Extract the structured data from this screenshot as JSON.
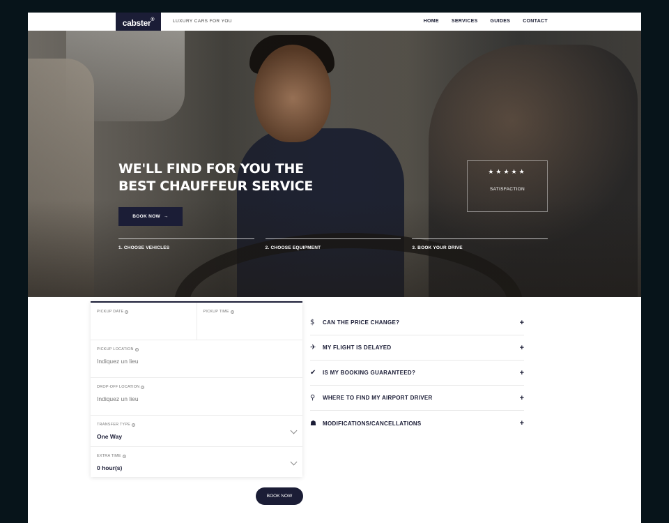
{
  "header": {
    "logo": "cabster",
    "logo_mark": "®",
    "tagline": "LUXURY CARS FOR YOU",
    "nav": [
      "HOME",
      "SERVICES",
      "GUIDES",
      "CONTACT"
    ]
  },
  "hero": {
    "title_line1": "WE'LL FIND FOR YOU THE",
    "title_line2": "BEST CHAUFFEUR SERVICE",
    "cta_label": "BOOK NOW",
    "cta_arrow": "→",
    "steps": [
      "1. CHOOSE VEHICLES",
      "2. CHOOSE EQUIPMENT",
      "3. BOOK YOUR DRIVE"
    ],
    "rating": {
      "stars": "★★★★★",
      "label": "SATISFACTION",
      "value": 5,
      "max": 5
    }
  },
  "form": {
    "pickup_date_label": "PICKUP DATE",
    "pickup_time_label": "PICKUP TIME",
    "pickup_location_label": "PICKUP LOCATION",
    "pickup_location_placeholder": "Indiquez un lieu",
    "dropoff_location_label": "DROP-OFF LOCATION",
    "dropoff_location_placeholder": "Indiquez un lieu",
    "transfer_type_label": "TRANSFER TYPE",
    "transfer_type_value": "One Way",
    "extra_time_label": "EXTRA TIME",
    "extra_time_value": "0 hour(s)",
    "info_glyph": "?",
    "submit_label": "BOOK NOW"
  },
  "faq": [
    {
      "icon": "dollar-icon",
      "glyph": "$",
      "question": "CAN THE PRICE CHANGE?"
    },
    {
      "icon": "plane-icon",
      "glyph": "✈",
      "question": "MY FLIGHT IS DELAYED"
    },
    {
      "icon": "check-badge-icon",
      "glyph": "✔",
      "question": "IS MY BOOKING GUARANTEED?"
    },
    {
      "icon": "location-pin-icon",
      "glyph": "⚲",
      "question": "WHERE TO FIND MY AIRPORT DRIVER"
    },
    {
      "icon": "user-hand-icon",
      "glyph": "☗",
      "question": "MODIFICATIONS/CANCELLATIONS"
    }
  ],
  "faq_toggle": "+",
  "colors": {
    "background": "#07141a",
    "primary": "#1b1d36",
    "white": "#ffffff"
  }
}
